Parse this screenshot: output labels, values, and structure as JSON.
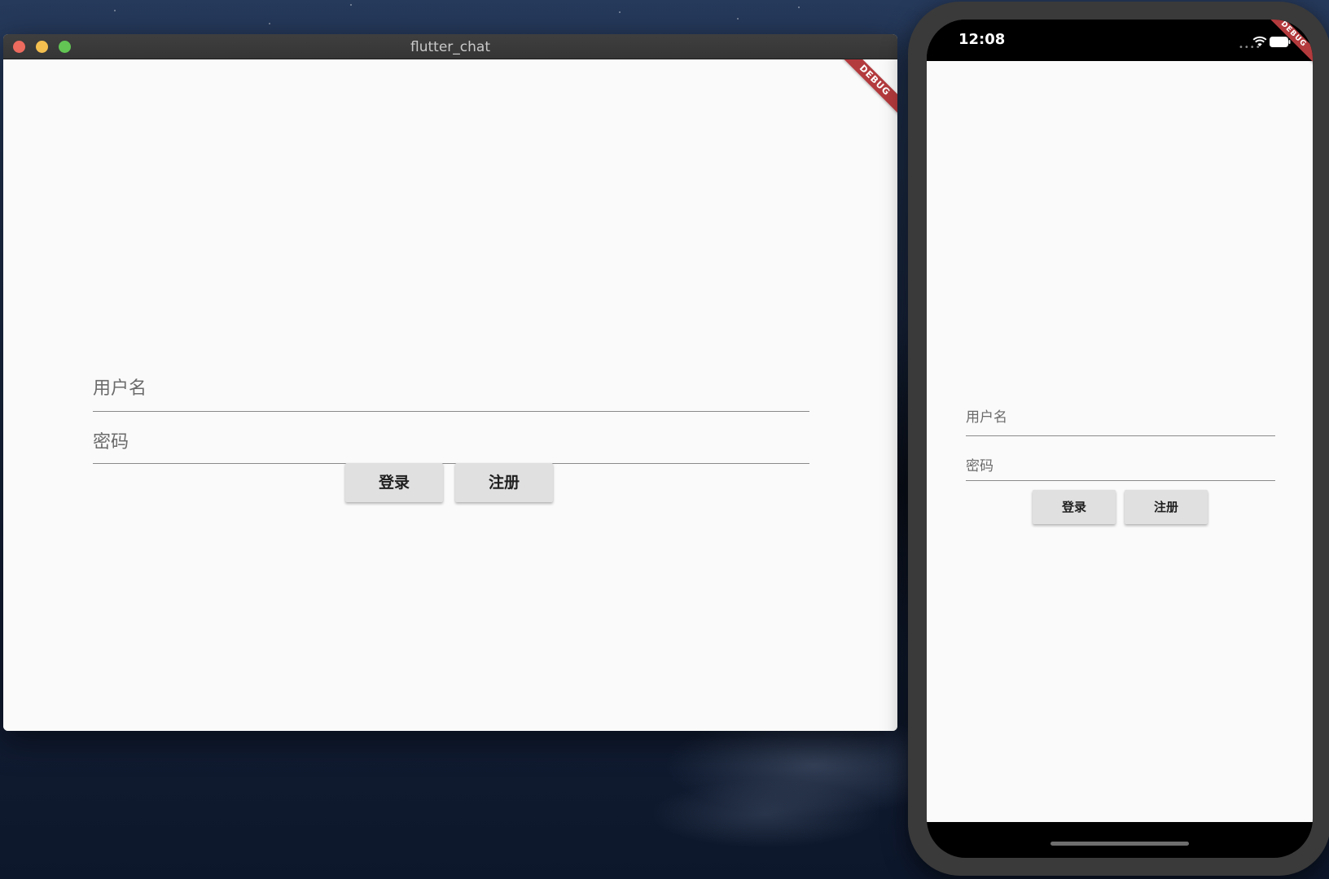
{
  "desktop_window": {
    "title": "flutter_chat",
    "debug_banner": "DEBUG",
    "form": {
      "username_label": "用户名",
      "password_label": "密码",
      "login_button": "登录",
      "register_button": "注册"
    }
  },
  "phone": {
    "status_bar": {
      "time": "12:08"
    },
    "debug_banner": "DEBUG",
    "form": {
      "username_label": "用户名",
      "password_label": "密码",
      "login_button": "登录",
      "register_button": "注册"
    }
  },
  "colors": {
    "debug_ribbon": "#b33a3d",
    "button_bg": "#e0e0e0",
    "app_bg": "#fafafa",
    "close": "#ed6a5e",
    "minimize": "#f5bf4f",
    "maximize": "#62c554"
  }
}
